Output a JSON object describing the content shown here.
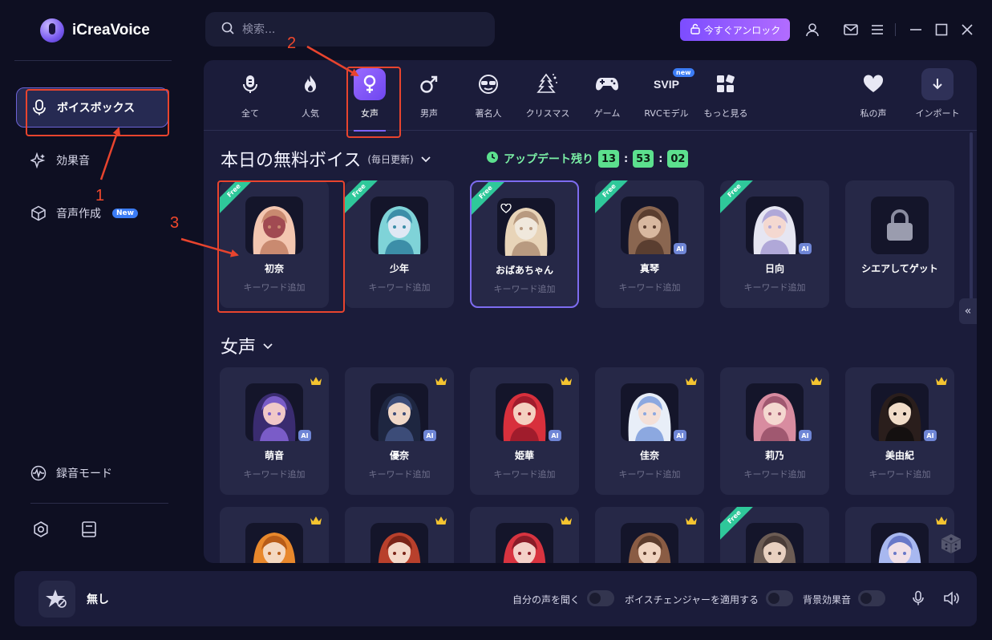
{
  "app": {
    "name": "iCreaVoice"
  },
  "sidebar": {
    "items": [
      {
        "label": "ボイスボックス",
        "active": true
      },
      {
        "label": "効果音"
      },
      {
        "label": "音声作成",
        "badge": "New"
      }
    ],
    "record_mode": "録音モード"
  },
  "topbar": {
    "search_placeholder": "検索...",
    "unlock_label": "今すぐアンロック"
  },
  "categories": [
    {
      "label": "全て"
    },
    {
      "label": "人気"
    },
    {
      "label": "女声",
      "active": true
    },
    {
      "label": "男声"
    },
    {
      "label": "著名人"
    },
    {
      "label": "クリスマス"
    },
    {
      "label": "ゲーム"
    },
    {
      "label": "RVCモデル",
      "badge": "new"
    },
    {
      "label": "もっと見る"
    },
    {
      "label": "私の声"
    },
    {
      "label": "インポート"
    }
  ],
  "free_section": {
    "title": "本日の無料ボイス",
    "subtitle": "(毎日更新)",
    "update_label": "アップデート残り",
    "countdown": {
      "h": "13",
      "m": "53",
      "s": "02"
    },
    "cards": [
      {
        "name": "初奈",
        "sub": "キーワード追加",
        "free": "Free",
        "palette": [
          "#f3c6b0",
          "#c98a70",
          "#a14a52"
        ]
      },
      {
        "name": "少年",
        "sub": "キーワード追加",
        "free": "Free",
        "palette": [
          "#7fd3d8",
          "#3c8ea8",
          "#e0e8f4"
        ]
      },
      {
        "name": "おばあちゃん",
        "sub": "キーワード追加",
        "free": "Free",
        "palette": [
          "#e8d4b8",
          "#b89a80",
          "#f0e8dc"
        ]
      },
      {
        "name": "真琴",
        "sub": "キーワード追加",
        "free": "Free",
        "ai": "AI",
        "palette": [
          "#8a6650",
          "#5a3e30",
          "#d8b8a0"
        ]
      },
      {
        "name": "日向",
        "sub": "キーワード追加",
        "free": "Free",
        "ai": "AI",
        "palette": [
          "#e6e6f2",
          "#b0a8d8",
          "#f4d8d0"
        ]
      },
      {
        "name": "シエアしてゲット",
        "lock": true
      }
    ]
  },
  "female_section": {
    "title": "女声",
    "cards": [
      {
        "name": "萌音",
        "sub": "キーワード追加",
        "ai": "AI",
        "palette": [
          "#3a2c70",
          "#7a5cc8",
          "#f0c8c8"
        ]
      },
      {
        "name": "優奈",
        "sub": "キーワード追加",
        "ai": "AI",
        "palette": [
          "#1e2640",
          "#3c4c78",
          "#f0d8c8"
        ]
      },
      {
        "name": "姫華",
        "sub": "キーワード追加",
        "ai": "AI",
        "palette": [
          "#d8303c",
          "#a01c2c",
          "#f4d0c0"
        ]
      },
      {
        "name": "佳奈",
        "sub": "キーワード追加",
        "ai": "AI",
        "palette": [
          "#e8eef8",
          "#8ca8e0",
          "#f4e0d8"
        ]
      },
      {
        "name": "莉乃",
        "sub": "キーワード追加",
        "ai": "AI",
        "palette": [
          "#d88ca0",
          "#a05870",
          "#f4d8d0"
        ]
      },
      {
        "name": "美由紀",
        "sub": "キーワード追加",
        "ai": "AI",
        "palette": [
          "#2a1e1c",
          "#141010",
          "#f0dcc8"
        ]
      }
    ],
    "row3": [
      {
        "palette": [
          "#e8882c",
          "#b85c18",
          "#f4d8c0"
        ]
      },
      {
        "palette": [
          "#b8402c",
          "#7a2418",
          "#f4d8c8"
        ]
      },
      {
        "palette": [
          "#d83440",
          "#8a1c28",
          "#f4d0c8"
        ]
      },
      {
        "palette": [
          "#8a5c44",
          "#5c3c2c",
          "#f0d4c0"
        ]
      },
      {
        "palette": [
          "#6c5c54",
          "#4a3c38",
          "#e8d0c0"
        ],
        "free": "Free"
      },
      {
        "palette": [
          "#a8b8f0",
          "#6878c8",
          "#f0e0e8"
        ]
      }
    ]
  },
  "bottom": {
    "voice_name": "無し",
    "toggles": [
      "自分の声を聞く",
      "ボイスチェンジャーを適用する",
      "背景効果音"
    ]
  },
  "annotations": {
    "n1": "1",
    "n2": "2",
    "n3": "3"
  },
  "colors": {
    "accent": "#7d63ff",
    "highlight": "#e8442e",
    "free": "#2fc89a",
    "timer": "#5ce08e"
  }
}
